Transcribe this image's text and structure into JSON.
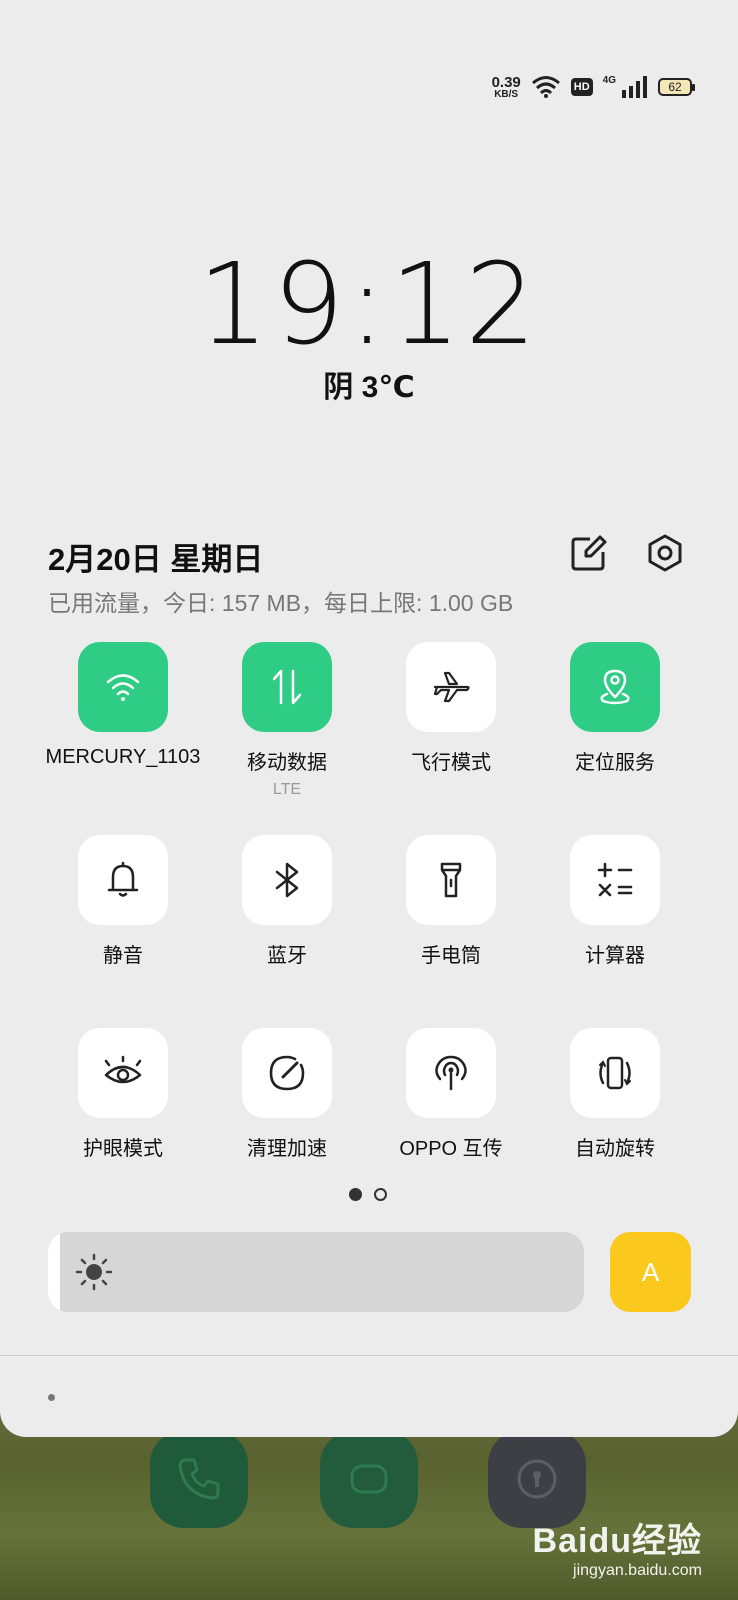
{
  "status_bar": {
    "net_speed": "0.39",
    "net_speed_unit": "KB/S",
    "hd_badge": "HD",
    "network_type": "4G",
    "battery": "62",
    "icons": [
      "wifi-icon",
      "hd-icon",
      "signal-icon",
      "battery-icon"
    ]
  },
  "clock": {
    "time": "19:12",
    "weather": "阴 3℃"
  },
  "header": {
    "date": "2月20日  星期日",
    "data_usage": "已用流量，今日: 157 MB，每日上限: 1.00 GB"
  },
  "tiles": [
    {
      "label": "MERCURY_1103",
      "icon": "wifi-icon",
      "active": true
    },
    {
      "label": "移动数据",
      "sublabel": "LTE",
      "icon": "mobile-data-icon",
      "active": true
    },
    {
      "label": "飞行模式",
      "icon": "airplane-icon",
      "active": false
    },
    {
      "label": "定位服务",
      "icon": "location-icon",
      "active": true
    },
    {
      "label": "静音",
      "icon": "bell-icon",
      "active": false
    },
    {
      "label": "蓝牙",
      "icon": "bluetooth-icon",
      "active": false
    },
    {
      "label": "手电筒",
      "icon": "flashlight-icon",
      "active": false
    },
    {
      "label": "计算器",
      "icon": "calculator-icon",
      "active": false
    },
    {
      "label": "护眼模式",
      "icon": "eye-icon",
      "active": false
    },
    {
      "label": "清理加速",
      "icon": "speed-gauge-icon",
      "active": false
    },
    {
      "label": "OPPO 互传",
      "icon": "share-signal-icon",
      "active": false
    },
    {
      "label": "自动旋转",
      "icon": "rotate-icon",
      "active": false
    }
  ],
  "pager": {
    "pages": 2,
    "current": 1
  },
  "brightness": {
    "level": 0.02,
    "auto_label": "A"
  },
  "colors": {
    "accent_green": "#2ecc85",
    "auto_yellow": "#fbc81e",
    "panel_bg": "#ececec"
  },
  "watermark": {
    "logo": "Baidu经验",
    "url": "jingyan.baidu.com"
  }
}
